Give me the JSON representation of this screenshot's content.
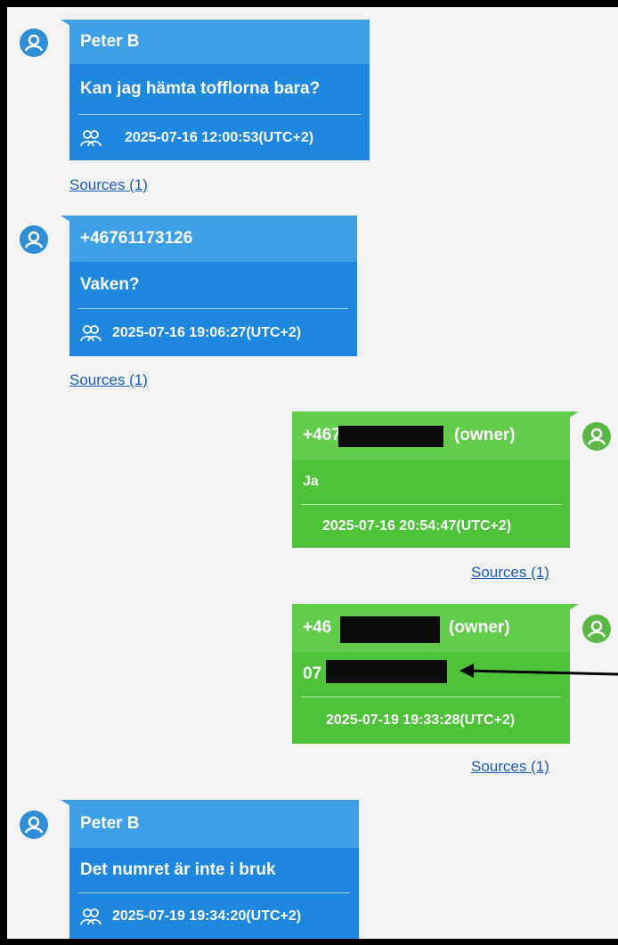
{
  "conversation": [
    {
      "direction": "incoming",
      "sender": "Peter B",
      "text": "Kan jag hämta tofflorna bara?",
      "timestamp": "2025-07-16 12:00:53(UTC+2)",
      "sources_label": "Sources (1)"
    },
    {
      "direction": "incoming",
      "sender": "+46761173126",
      "text": "Vaken?",
      "timestamp": "2025-07-16 19:06:27(UTC+2)",
      "sources_label": "Sources (1)"
    },
    {
      "direction": "outgoing",
      "sender_prefix": "+467",
      "sender_suffix": "(owner)",
      "text": "Ja",
      "timestamp": "2025-07-16 20:54:47(UTC+2)",
      "sources_label": "Sources (1)"
    },
    {
      "direction": "outgoing",
      "sender_prefix": "+46",
      "sender_suffix": "(owner)",
      "text": "07",
      "timestamp": "2025-07-19 19:33:28(UTC+2)",
      "sources_label": "Sources (1)"
    },
    {
      "direction": "incoming",
      "sender": "Peter B",
      "text": "Det numret är inte i bruk",
      "timestamp": "2025-07-19 19:34:20(UTC+2)",
      "sources_label": "Sources (1)"
    }
  ],
  "colors": {
    "incoming": "#1e88de",
    "outgoing": "#4ec33a",
    "link": "#1a5fb4",
    "background": "#f3f3f3",
    "redaction": "#0d0d0d"
  },
  "icons": {
    "avatar": "user-circle-icon",
    "group": "group-icon",
    "annotation": "arrow-left-icon"
  }
}
